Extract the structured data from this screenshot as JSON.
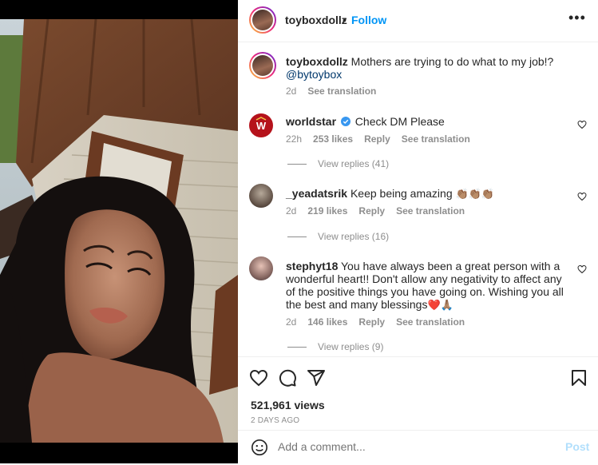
{
  "header": {
    "username": "toyboxdollz",
    "separator": "•",
    "follow_label": "Follow",
    "more_label": "•••"
  },
  "caption": {
    "username": "toyboxdollz",
    "text": "Mothers are trying to do what to my job!?",
    "mention": "@bytoybox",
    "time": "2d",
    "see_translation": "See translation"
  },
  "comments": [
    {
      "username": "worldstar",
      "verified": true,
      "text": "Check DM Please",
      "time": "22h",
      "likes": "253 likes",
      "reply": "Reply",
      "see_translation": "See translation",
      "view_replies": "View replies (41)"
    },
    {
      "username": "_yeadatsrik",
      "text": "Keep being amazing",
      "emoji": "👏🏽👏🏽👏🏽",
      "time": "2d",
      "likes": "219 likes",
      "reply": "Reply",
      "see_translation": "See translation",
      "view_replies": "View replies (16)"
    },
    {
      "username": "stephyt18",
      "text": "You have always been a great person with a wonderful heart!! Don't allow any negativity to affect any of the positive things you have going on. Wishing you all the best and many blessings",
      "emoji": "❤️🙏🏽",
      "time": "2d",
      "likes": "146 likes",
      "reply": "Reply",
      "see_translation": "See translation",
      "view_replies": "View replies (9)"
    }
  ],
  "stats": {
    "views": "521,961 views",
    "posted_ago": "2 DAYS AGO"
  },
  "add_comment": {
    "placeholder": "Add a comment...",
    "post_label": "Post"
  },
  "colors": {
    "accent": "#0095f6",
    "link": "#00376b",
    "muted": "#8e8e8e",
    "post_disabled": "#b2dffc",
    "worldstar_red": "#b5121b",
    "verified": "#3897f0"
  },
  "icons": [
    "heart-icon",
    "comment-icon",
    "share-icon",
    "bookmark-icon",
    "emoji-icon",
    "verified-badge-icon",
    "more-options-icon"
  ]
}
